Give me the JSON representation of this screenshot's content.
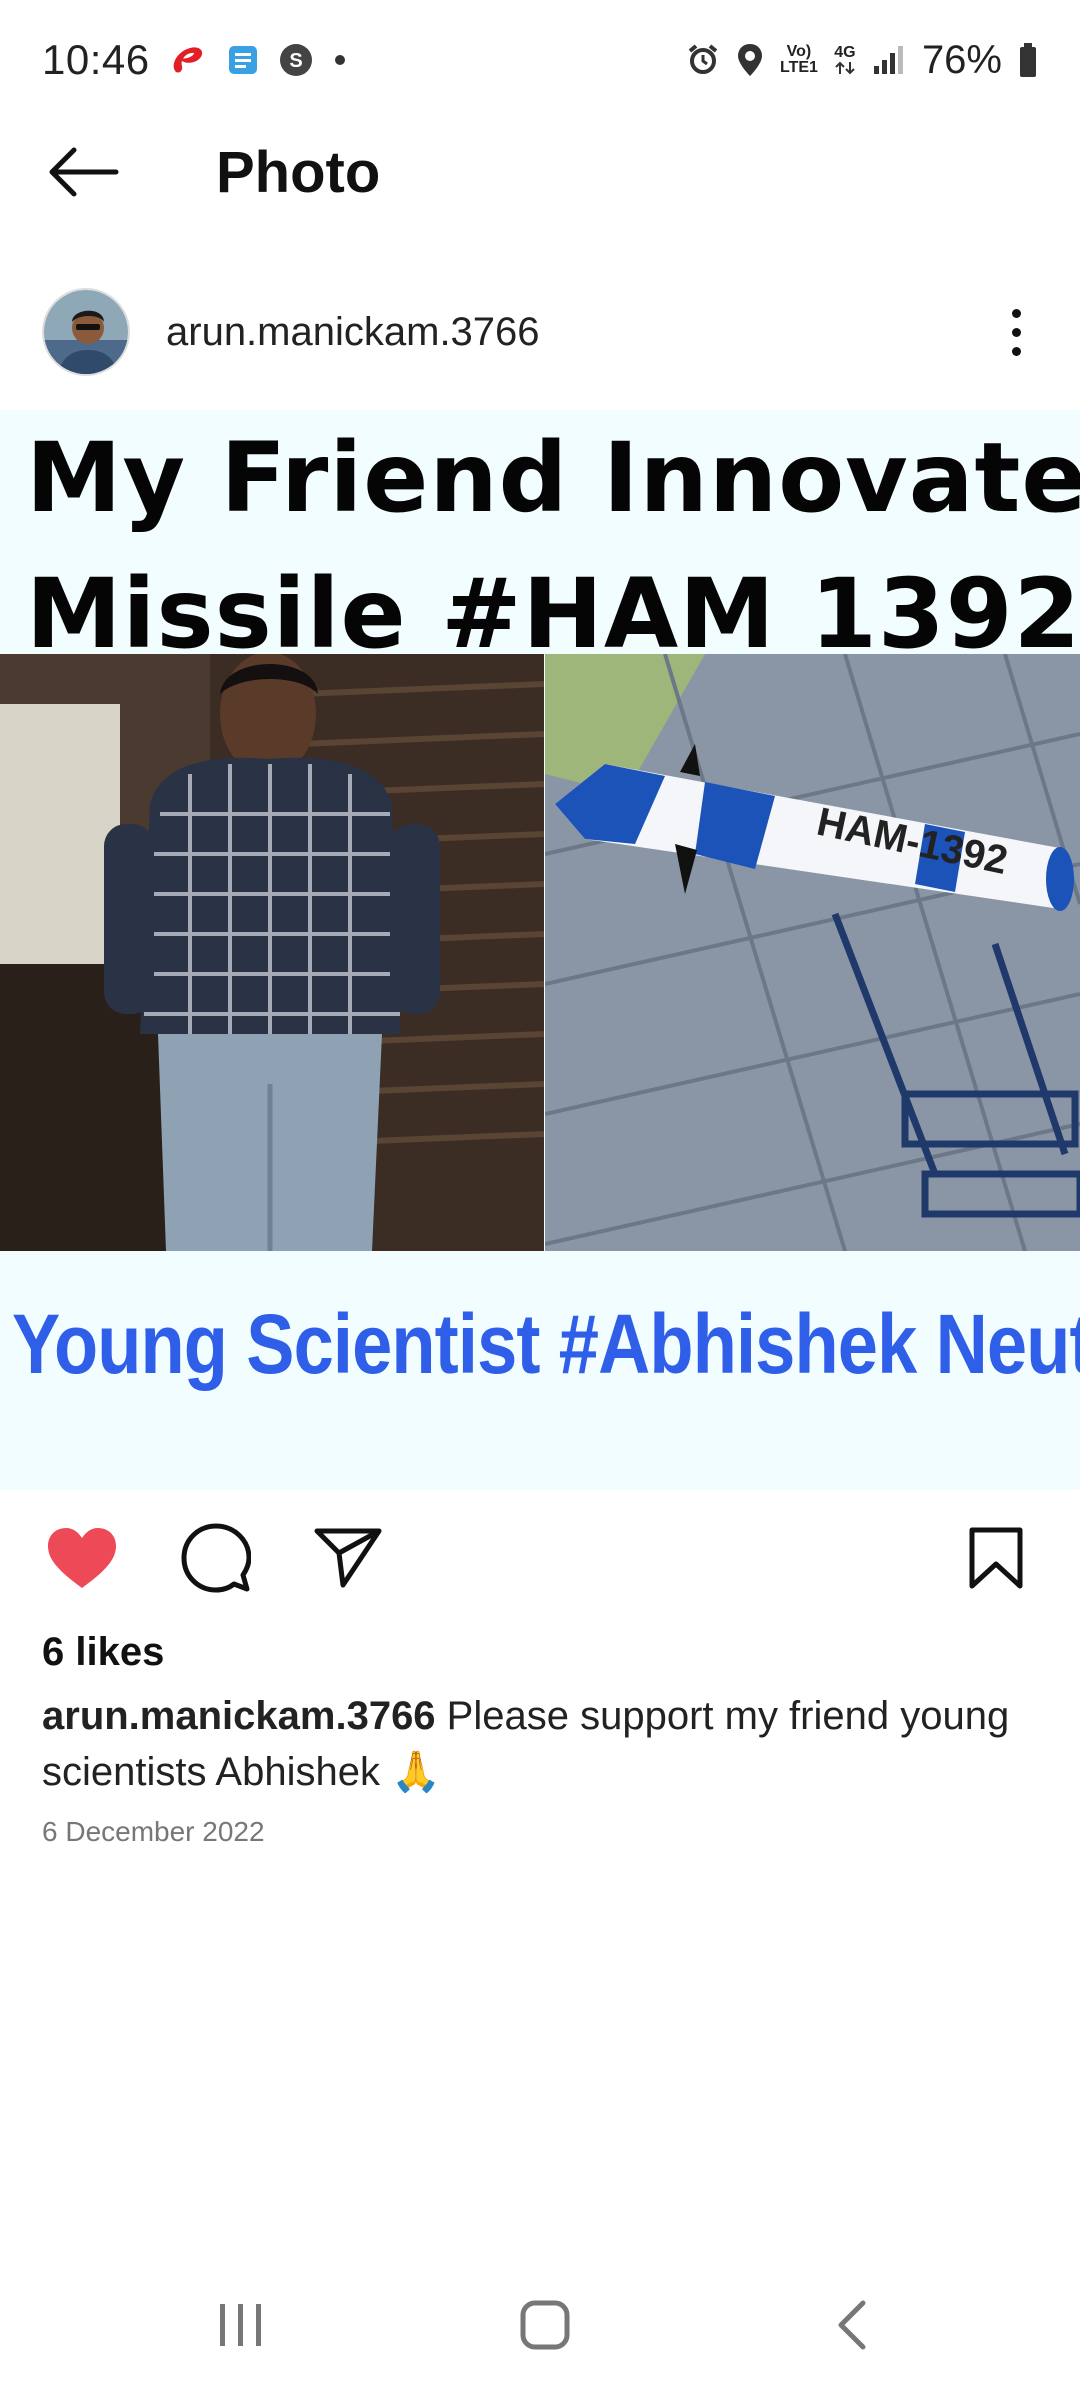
{
  "status_bar": {
    "time": "10:46",
    "network_label_top": "Vo)",
    "network_label_bottom": "LTE1",
    "network_type": "4G",
    "battery": "76%",
    "icons": [
      "airtel-icon",
      "notes-icon",
      "s-app-icon",
      "dot-icon",
      "alarm-icon",
      "location-icon",
      "volte-icon",
      "4g-icon",
      "signal-icon",
      "battery-icon"
    ]
  },
  "app_bar": {
    "title": "Photo"
  },
  "post": {
    "username": "arun.manickam.3766",
    "image": {
      "headline_line1": "My Friend Innovate",
      "headline_line2": "Missile #HAM 1392",
      "rocket_label": "HAM-1392",
      "caption": "Young Scientist #Abhishek Neutral Ultra"
    },
    "likes": "6 likes",
    "caption_user": "arun.manickam.3766",
    "caption_text": " Please support my friend young scientists Abhishek 🙏",
    "date": "6 December 2022"
  },
  "colors": {
    "like_red": "#ed4956",
    "caption_blue": "#2f5ee8",
    "image_bg": "#f1fdfe"
  }
}
